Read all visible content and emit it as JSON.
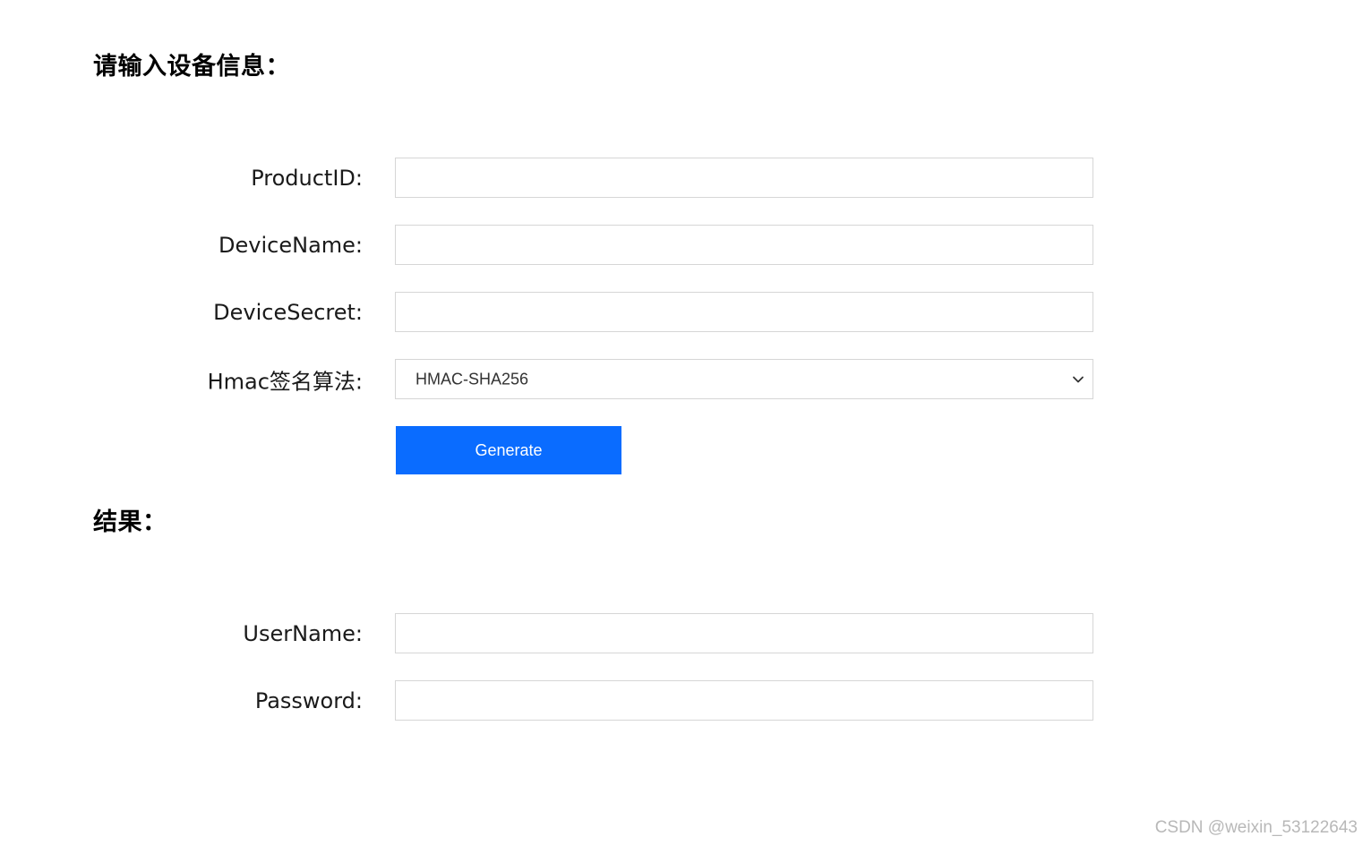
{
  "headings": {
    "input_title": "请输入设备信息：",
    "result_title": "结果："
  },
  "form": {
    "product_id": {
      "label": "ProductID:",
      "value": "",
      "placeholder": ""
    },
    "device_name": {
      "label": "DeviceName:",
      "value": "",
      "placeholder": ""
    },
    "device_secret": {
      "label": "DeviceSecret:",
      "value": "",
      "placeholder": ""
    },
    "hmac": {
      "label": "Hmac签名算法:",
      "selected": "HMAC-SHA256",
      "icon": "chevron-down-icon"
    },
    "generate_label": "Generate"
  },
  "result": {
    "username": {
      "label": "UserName:",
      "value": "",
      "placeholder": ""
    },
    "password": {
      "label": "Password:",
      "value": "",
      "placeholder": ""
    }
  },
  "watermark": "CSDN @weixin_53122643",
  "colors": {
    "button_bg": "#0a6cff",
    "button_text": "#ffffff",
    "field_border": "#d6d6d6",
    "watermark": "#b8b8b8"
  }
}
